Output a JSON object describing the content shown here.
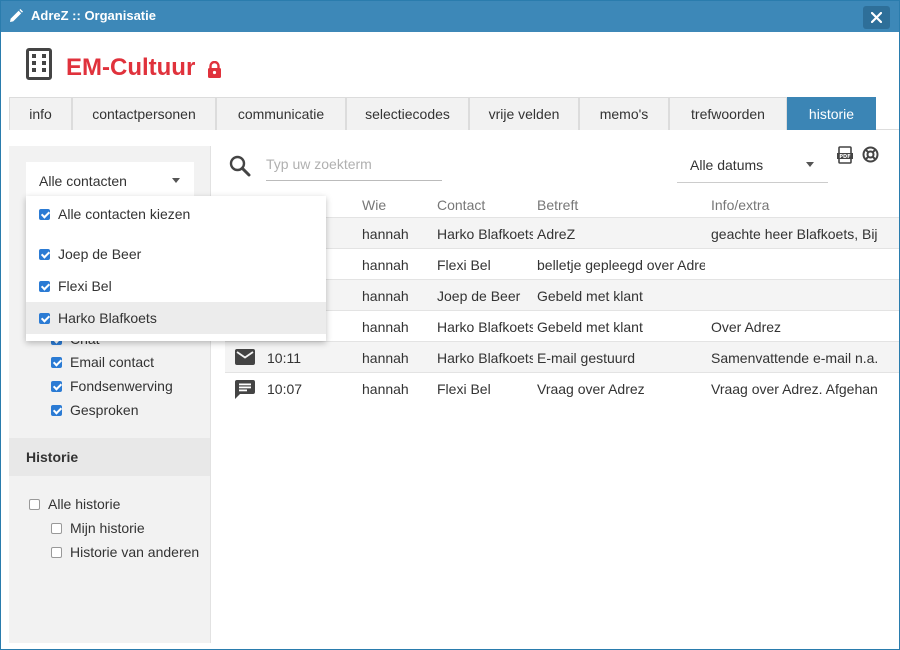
{
  "window": {
    "title": "AdreZ :: Organisatie"
  },
  "header": {
    "org_name": "EM-Cultuur"
  },
  "tabs": [
    {
      "label": "info",
      "active": false
    },
    {
      "label": "contactpersonen",
      "active": false
    },
    {
      "label": "communicatie",
      "active": false
    },
    {
      "label": "selectiecodes",
      "active": false
    },
    {
      "label": "vrije velden",
      "active": false
    },
    {
      "label": "memo's",
      "active": false
    },
    {
      "label": "trefwoorden",
      "active": false
    },
    {
      "label": "historie",
      "active": true
    }
  ],
  "sidebar": {
    "contact_select": "Alle contacten",
    "type_filters": [
      {
        "label": "Chat",
        "checked": true
      },
      {
        "label": "Email contact",
        "checked": true
      },
      {
        "label": "Fondsenwerving",
        "checked": true
      },
      {
        "label": "Gesproken",
        "checked": true
      }
    ],
    "historie_heading": "Historie",
    "historie_filters": [
      {
        "label": "Alle historie",
        "checked": false
      },
      {
        "label": "Mijn historie",
        "checked": false
      },
      {
        "label": "Historie van anderen",
        "checked": false
      }
    ]
  },
  "dropdown": {
    "items": [
      {
        "label": "Alle contacten kiezen",
        "checked": true
      },
      {
        "label": "Joep de Beer",
        "checked": true
      },
      {
        "label": "Flexi Bel",
        "checked": true
      },
      {
        "label": "Harko Blafkoets",
        "checked": true
      }
    ]
  },
  "main": {
    "search_placeholder": "Typ uw zoekterm",
    "date_select": "Alle datums",
    "columns": {
      "wie": "Wie",
      "contact": "Contact",
      "betreft": "Betreft",
      "info": "Info/extra"
    },
    "rows": [
      {
        "icon": "none",
        "time": "",
        "wie": "hannah",
        "contact": "Harko Blafkoets",
        "betreft": "AdreZ",
        "info": "geachte heer Blafkoets, Bij"
      },
      {
        "icon": "none",
        "time": "",
        "wie": "hannah",
        "contact": "Flexi Bel",
        "betreft": "belletje gepleegd over Adre",
        "info": ""
      },
      {
        "icon": "none",
        "time": "",
        "wie": "hannah",
        "contact": "Joep de Beer",
        "betreft": "Gebeld met klant",
        "info": ""
      },
      {
        "icon": "none",
        "time": "",
        "wie": "hannah",
        "contact": "Harko Blafkoets",
        "betreft": "Gebeld met klant",
        "info": "Over Adrez"
      },
      {
        "icon": "email-icon",
        "time": "10:11",
        "wie": "hannah",
        "contact": "Harko Blafkoets",
        "betreft": "E-mail gestuurd",
        "info": "Samenvattende e-mail n.a."
      },
      {
        "icon": "chat-icon",
        "time": "10:07",
        "wie": "hannah",
        "contact": "Flexi Bel",
        "betreft": "Vraag over Adrez",
        "info": "Vraag over Adrez. Afgehan"
      }
    ]
  },
  "colors": {
    "titlebar": "#3d88b8",
    "accent": "#3b85b5",
    "org_name": "#e0323c",
    "checkbox": "#2b7bd4"
  }
}
